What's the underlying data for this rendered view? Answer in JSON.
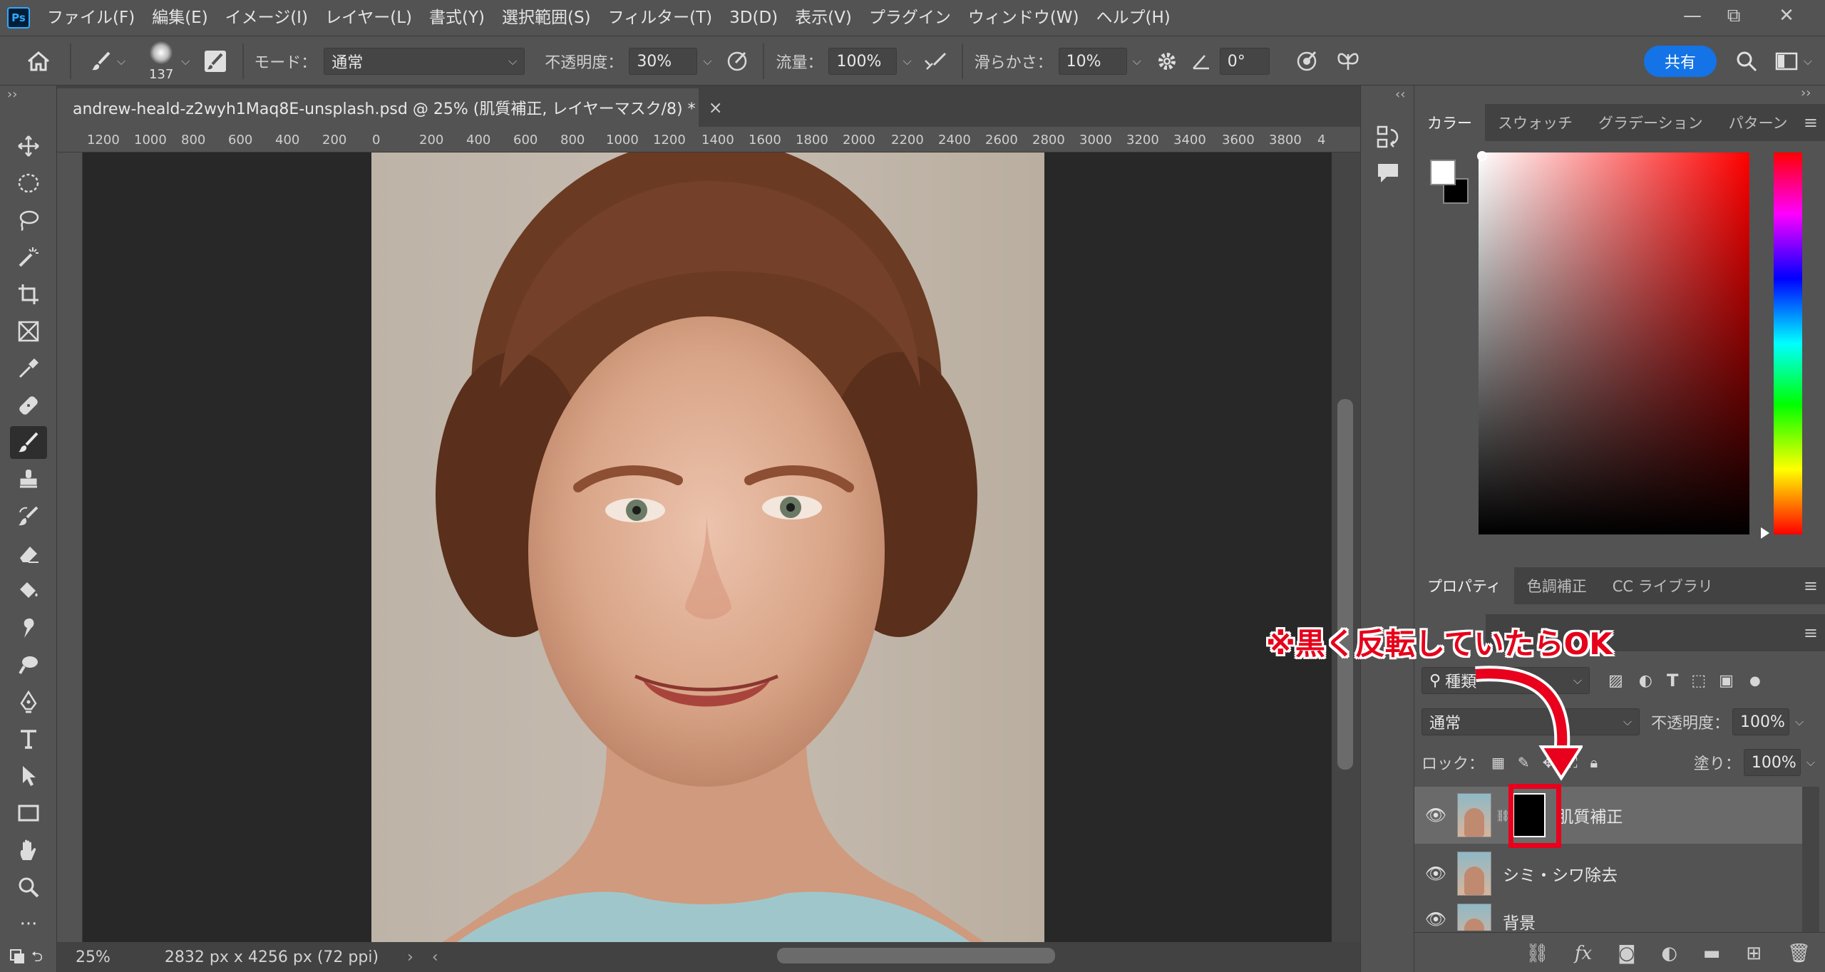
{
  "app": {
    "logo": "Ps"
  },
  "menu": [
    "ファイル(F)",
    "編集(E)",
    "イメージ(I)",
    "レイヤー(L)",
    "書式(Y)",
    "選択範囲(S)",
    "フィルター(T)",
    "3D(D)",
    "表示(V)",
    "プラグイン",
    "ウィンドウ(W)",
    "ヘルプ(H)"
  ],
  "window_controls": {
    "minimize": "—",
    "restore": "⧉",
    "close": "✕"
  },
  "options": {
    "brush_size": "137",
    "mode_label": "モード：",
    "mode_value": "通常",
    "opacity_label": "不透明度：",
    "opacity_value": "30%",
    "flow_label": "流量：",
    "flow_value": "100%",
    "smoothing_label": "滑らかさ：",
    "smoothing_value": "10%",
    "angle_value": "0°",
    "share_label": "共有"
  },
  "document": {
    "tab_title": "andrew-heald-z2wyh1Maq8E-unsplash.psd @ 25% (肌質補正, レイヤーマスク/8) *",
    "close": "×",
    "ruler_ticks": [
      "1200",
      "1000",
      "800",
      "600",
      "400",
      "200",
      "0",
      "200",
      "400",
      "600",
      "800",
      "1000",
      "1200",
      "1400",
      "1600",
      "1800",
      "2000",
      "2200",
      "2400",
      "2600",
      "2800",
      "3000",
      "3200",
      "3400",
      "3600",
      "3800",
      "4"
    ],
    "zoom": "25%",
    "dimensions": "2832 px x 4256 px (72 ppi)"
  },
  "color_panel": {
    "tabs": [
      "カラー",
      "スウォッチ",
      "グラデーション",
      "パターン"
    ],
    "active_tab": "カラー",
    "foreground": "#ffffff",
    "background": "#000000"
  },
  "properties_panel": {
    "tabs": [
      "プロパティ",
      "色調補正",
      "CC ライブラリ"
    ],
    "active_tab": "プロパティ"
  },
  "layers_panel": {
    "filter_label": "種類",
    "blend_mode": "通常",
    "opacity_label": "不透明度：",
    "opacity_value": "100%",
    "lock_label": "ロック：",
    "fill_label": "塗り：",
    "fill_value": "100%",
    "layers": [
      {
        "name": "肌質補正",
        "selected": true,
        "has_mask": true
      },
      {
        "name": "シミ・シワ除去",
        "selected": false,
        "has_mask": false
      },
      {
        "name": "背景",
        "selected": false,
        "has_mask": false
      }
    ]
  },
  "annotation": {
    "text": "※黒く反転していたらOK",
    "color": "#e6001a"
  }
}
